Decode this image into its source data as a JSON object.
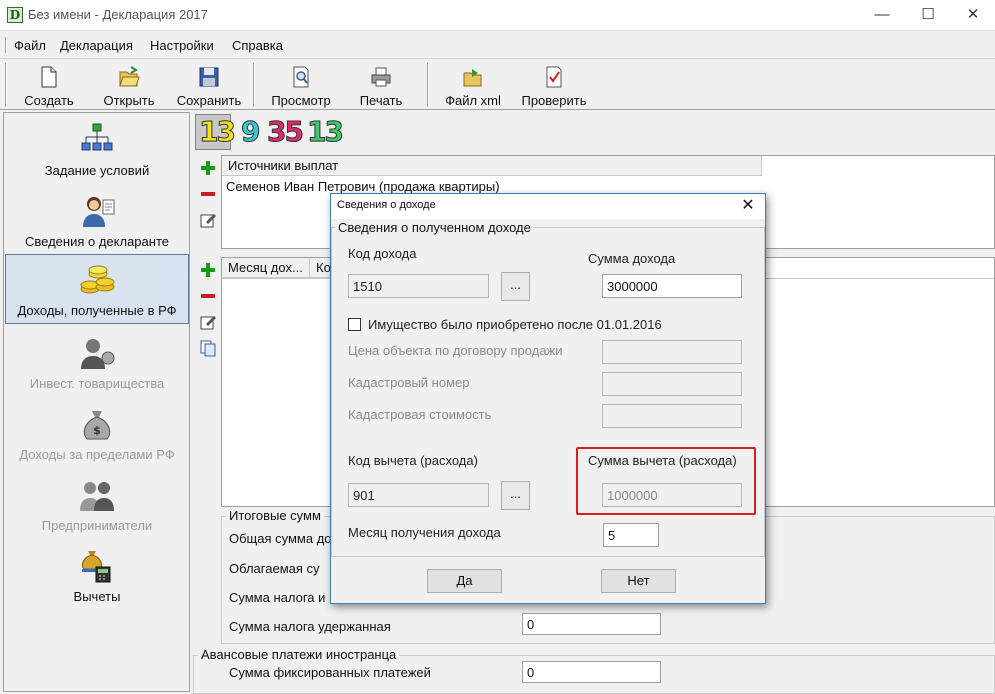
{
  "window": {
    "title": "Без имени - Декларация 2017",
    "app_icon_letter": "D",
    "controls": {
      "minimize": "—",
      "maximize": "☐",
      "close": "✕"
    }
  },
  "menu": {
    "items": [
      "Файл",
      "Декларация",
      "Настройки",
      "Справка"
    ]
  },
  "toolbar": {
    "buttons": [
      {
        "label": "Создать",
        "icon": "new-document-icon"
      },
      {
        "label": "Открыть",
        "icon": "open-folder-icon"
      },
      {
        "label": "Сохранить",
        "icon": "floppy-save-icon"
      },
      {
        "label": "Просмотр",
        "icon": "preview-magnifier-icon"
      },
      {
        "label": "Печать",
        "icon": "printer-icon"
      },
      {
        "label": "Файл xml",
        "icon": "xml-export-icon"
      },
      {
        "label": "Проверить",
        "icon": "check-document-icon"
      }
    ]
  },
  "sidebar": {
    "items": [
      {
        "label": "Задание условий",
        "icon": "conditions-tree-icon",
        "state": "normal"
      },
      {
        "label": "Сведения о декларанте",
        "icon": "declarant-person-icon",
        "state": "normal"
      },
      {
        "label": "Доходы, полученные в РФ",
        "icon": "coins-icon",
        "state": "active"
      },
      {
        "label": "Инвест. товарищества",
        "icon": "investor-person-icon",
        "state": "disabled"
      },
      {
        "label": "Доходы за пределами РФ",
        "icon": "money-bag-icon",
        "state": "disabled"
      },
      {
        "label": "Предприниматели",
        "icon": "entrepreneurs-icon",
        "state": "disabled"
      },
      {
        "label": "Вычеты",
        "icon": "deductions-icon",
        "state": "normal"
      }
    ]
  },
  "rates": {
    "items": [
      {
        "value": "13",
        "color": "#f2e21a",
        "selected": true
      },
      {
        "value": "9",
        "color": "#35c8d8",
        "selected": false
      },
      {
        "value": "35",
        "color": "#e0286e",
        "selected": false
      },
      {
        "value": "13",
        "color": "#3fc86a",
        "selected": false
      }
    ]
  },
  "sources": {
    "header": "Источники выплат",
    "rows": [
      "Семенов Иван Петрович (продажа квартиры)"
    ]
  },
  "months_table": {
    "headers": [
      "Месяц дох...",
      "Ко"
    ]
  },
  "totals": {
    "group_title": "Итоговые сумм",
    "rows": [
      {
        "label": "Общая сумма до",
        "value": ""
      },
      {
        "label": "Облагаемая су",
        "value": ""
      },
      {
        "label": "Сумма налога и",
        "value": ""
      },
      {
        "label": "Сумма налога удержанная",
        "value": "0"
      }
    ]
  },
  "advance": {
    "group_title": "Авансовые платежи иностранца",
    "label": "Сумма фиксированных платежей",
    "value": "0"
  },
  "dialog": {
    "title": "Сведения о доходе",
    "close": "✕",
    "group_title": "Сведения о полученном доходе",
    "income_code_label": "Код дохода",
    "income_code_value": "1510",
    "income_sum_label": "Сумма дохода",
    "income_sum_value": "3000000",
    "ellipsis": "...",
    "checkbox_label": "Имущество было приобретено после 01.01.2016",
    "checkbox_checked": false,
    "contract_price_label": "Цена объекта по договору продажи",
    "cadastral_number_label": "Кадастровый номер",
    "cadastral_value_label": "Кадастровая стоимость",
    "deduction_code_label": "Код вычета (расхода)",
    "deduction_code_value": "901",
    "deduction_sum_label": "Сумма вычета (расхода)",
    "deduction_sum_value": "1000000",
    "month_label": "Месяц получения дохода",
    "month_value": "5",
    "ok_label": "Да",
    "cancel_label": "Нет",
    "highlight_color": "#d42020"
  }
}
